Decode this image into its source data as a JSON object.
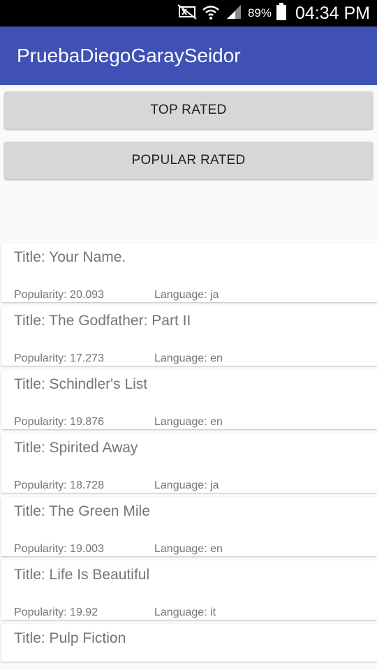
{
  "status_bar": {
    "battery": "89%",
    "time": "04:34 PM",
    "icons": [
      "mute-icon",
      "wifi-icon",
      "signal-icon",
      "battery-icon"
    ]
  },
  "app_bar": {
    "title": "PruebaDiegoGaraySeidor",
    "color": "#3f51b5"
  },
  "buttons": {
    "top_rated": "TOP RATED",
    "popular_rated": "POPULAR RATED"
  },
  "movies": [
    {
      "title": "Title: Your Name.",
      "popularity": "Popularity: 20.093",
      "language": "Language: ja"
    },
    {
      "title": "Title: The Godfather: Part II",
      "popularity": "Popularity: 17.273",
      "language": "Language: en"
    },
    {
      "title": "Title: Schindler's List",
      "popularity": "Popularity: 19.876",
      "language": "Language: en"
    },
    {
      "title": "Title: Spirited Away",
      "popularity": "Popularity: 18.728",
      "language": "Language: ja"
    },
    {
      "title": "Title: The Green Mile",
      "popularity": "Popularity: 19.003",
      "language": "Language: en"
    },
    {
      "title": "Title: Life Is Beautiful",
      "popularity": "Popularity: 19.92",
      "language": "Language: it"
    },
    {
      "title": "Title: Pulp Fiction",
      "popularity": "",
      "language": ""
    }
  ]
}
